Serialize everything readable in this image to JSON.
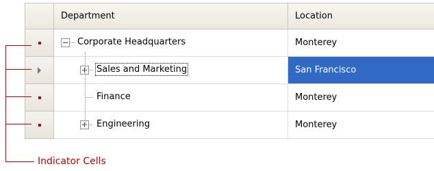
{
  "columns": {
    "department": "Department",
    "location": "Location"
  },
  "rows": [
    {
      "department": "Corporate Headquarters",
      "location": "Monterey",
      "indicator": "dot",
      "expander": "minus",
      "selected": false,
      "focused": false
    },
    {
      "department": "Sales and Marketing",
      "location": "San Francisco",
      "indicator": "arrow",
      "expander": "plus",
      "selected": true,
      "focused": true
    },
    {
      "department": "Finance",
      "location": "Monterey",
      "indicator": "dot",
      "expander": "none",
      "selected": false,
      "focused": false
    },
    {
      "department": "Engineering",
      "location": "Monterey",
      "indicator": "dot",
      "expander": "plus",
      "selected": false,
      "focused": false
    }
  ],
  "callout": {
    "label": "Indicator Cells",
    "color": "#c00000"
  },
  "selection_color": "#316ac5"
}
